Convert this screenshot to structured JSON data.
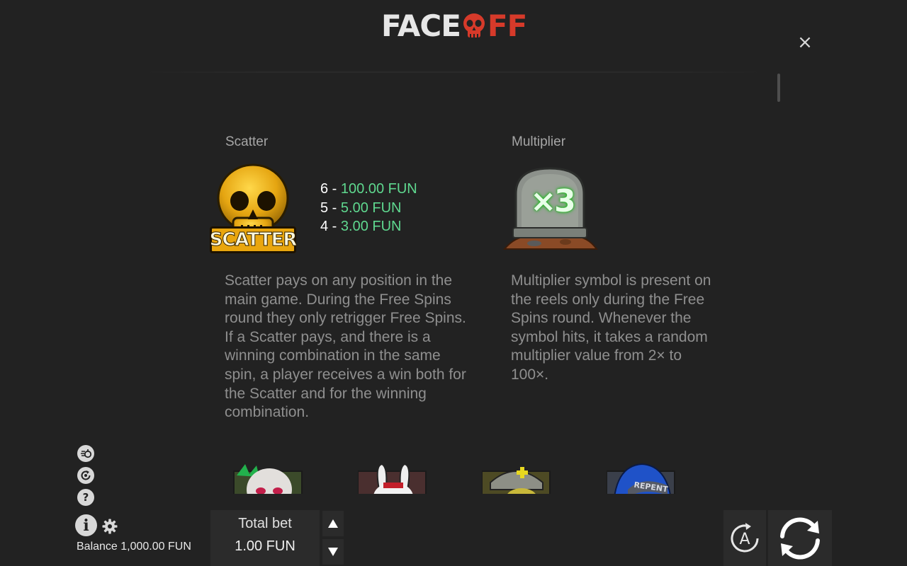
{
  "header": {
    "logo_text_left": "FACE",
    "logo_text_right": "FF",
    "close_label": "×"
  },
  "scatter": {
    "title": "Scatter",
    "symbol_label": "SCATTER",
    "payouts": [
      {
        "count": "6 -",
        "value": "100.00 FUN"
      },
      {
        "count": "5 -",
        "value": "5.00 FUN"
      },
      {
        "count": "4 -",
        "value": "3.00 FUN"
      }
    ],
    "description": [
      "Scatter pays on any position in the",
      "main game. During the Free Spins",
      "round they only retrigger Free Spins.",
      "If a Scatter pays, and there is a",
      "winning combination in the same",
      "spin, a player receives a win both for",
      "the Scatter and for the winning",
      "combination."
    ]
  },
  "multiplier": {
    "title": "Multiplier",
    "symbol_label": "×3",
    "description": [
      "Multiplier symbol is present on",
      "the reels only during the Free",
      "Spins round. Whenever the",
      "symbol hits, it takes a random",
      "multiplier value from 2× to",
      "100×."
    ]
  },
  "peek_symbols": [
    "joker-symbol",
    "rabbit-symbol",
    "nurse-symbol",
    "repent-symbol"
  ],
  "peek_text": "REPENT",
  "controls": {
    "info_label": "i",
    "help_label": "?",
    "balance_text": "Balance 1,000.00 FUN",
    "bet_label": "Total bet",
    "bet_value": "1.00 FUN",
    "auto_label": "A"
  },
  "colors": {
    "background": "#222222",
    "win_value": "#5fd88f",
    "logo_red": "#d63a2a"
  }
}
